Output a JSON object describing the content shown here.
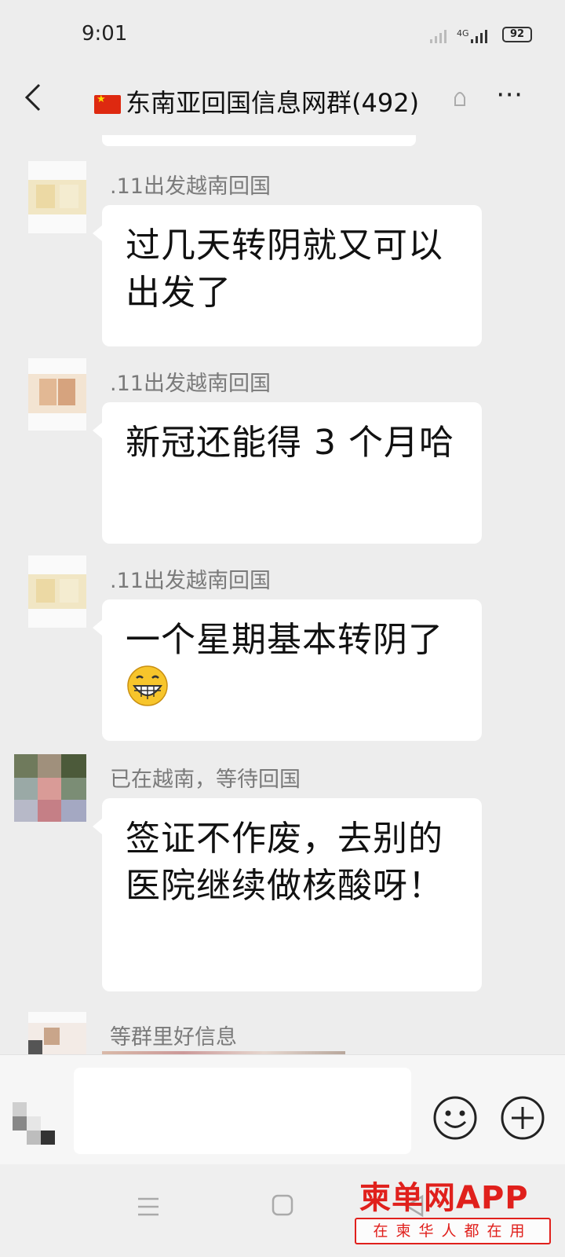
{
  "status_bar": {
    "time": "9:01",
    "network": "4G",
    "battery": "92"
  },
  "header": {
    "title": "东南亚回国信息网群(492)"
  },
  "messages": [
    {
      "sender": ".11出发越南回国",
      "text": "过几天转阴就又可以出发了",
      "emoji": ""
    },
    {
      "sender": ".11出发越南回国",
      "text": "新冠还能得 3 个月哈",
      "emoji": ""
    },
    {
      "sender": ".11出发越南回国",
      "text": "一个星期基本转阴了",
      "emoji": "grin-icon"
    },
    {
      "sender": "已在越南，等待回国",
      "text": "签证不作废，去别的医院继续做核酸呀！",
      "emoji": ""
    },
    {
      "sender": "等群里好信息",
      "text": "",
      "emoji": ""
    }
  ],
  "input": {
    "placeholder": ""
  },
  "watermark": {
    "logo": "柬单网APP",
    "slogan": "在柬华人都在用"
  },
  "colors": {
    "background": "#ededed",
    "bubble": "#ffffff",
    "sender": "#7a7a7a",
    "watermark": "#e0201c"
  }
}
